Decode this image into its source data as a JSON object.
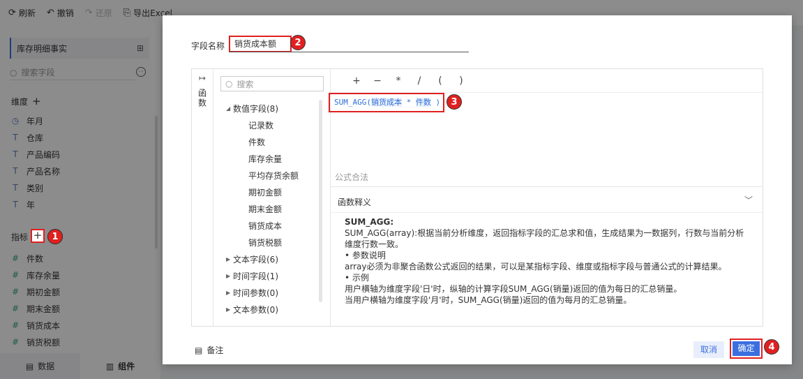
{
  "toolbar": {
    "refresh": "刷新",
    "undo": "撤销",
    "redo": "还原",
    "export": "导出Excel"
  },
  "left": {
    "table_name": "库存明细事实",
    "search_placeholder": "搜索字段",
    "dimension_title": "维度",
    "dimensions": [
      {
        "icon": "clock-icon",
        "label": "年月"
      },
      {
        "icon": "text-icon",
        "label": "仓库"
      },
      {
        "icon": "text-icon",
        "label": "产品编码"
      },
      {
        "icon": "text-icon",
        "label": "产品名称"
      },
      {
        "icon": "text-icon",
        "label": "类别"
      },
      {
        "icon": "text-icon",
        "label": "年"
      }
    ],
    "measure_title": "指标",
    "measures": [
      "件数",
      "库存余量",
      "期初金额",
      "期末金额",
      "销货成本",
      "销货税额"
    ],
    "tabs": {
      "data": "数据",
      "component": "组件"
    }
  },
  "dialog": {
    "field_name_label": "字段名称",
    "field_name_value": "销货成本额",
    "rail_label": "函数",
    "tree_search_placeholder": "搜索",
    "tree": {
      "numeric": {
        "label": "数值字段(8)",
        "items": [
          "记录数",
          "件数",
          "库存余量",
          "平均存货余额",
          "期初金额",
          "期末金额",
          "销货成本",
          "销货税额"
        ]
      },
      "collapsed": [
        "文本字段(6)",
        "时间字段(1)",
        "时间参数(0)",
        "文本参数(0)"
      ]
    },
    "operators": [
      "+",
      "−",
      "*",
      "/",
      "(",
      ")"
    ],
    "formula": {
      "fn": "SUM_AGG(",
      "field1": "销货成本",
      "op": " * ",
      "field2": "件数",
      "close": " )"
    },
    "validity": "公式合法",
    "help_title": "函数释义",
    "doc": {
      "name": "SUM_AGG:",
      "line1": "SUM_AGG(array):根据当前分析维度，返回指标字段的汇总求和值，生成结果为一数据列，行数与当前分析维度行数一致。",
      "line2": "• 参数说明",
      "line3": "array必须为非聚合函数公式返回的结果，可以是某指标字段、维度或指标字段与普通公式的计算结果。",
      "line4": "• 示例",
      "line5": "用户横轴为维度字段'日'时，纵轴的计算字段SUM_AGG(销量)返回的值为每日的汇总销量。",
      "line6": "当用户横轴为维度字段'月'时，SUM_AGG(销量)返回的值为每月的汇总销量。"
    },
    "note_label": "备注",
    "cancel": "取消",
    "ok": "确定"
  },
  "badges": [
    "1",
    "2",
    "3",
    "4"
  ],
  "colors": {
    "accent": "#3b6fe0",
    "highlight": "#e02020"
  }
}
